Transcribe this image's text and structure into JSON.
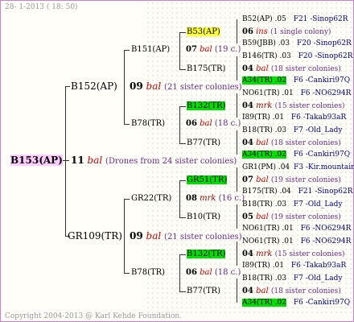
{
  "header": "28- 1-2013 ( 18: 50)",
  "footer": "Copyright 2004-2013 @ Karl Kehde Foundation.",
  "root": {
    "queen": "B153(AP)",
    "num": "11",
    "mark": "bal",
    "note": "(Drones from 24 sister colonies)"
  },
  "g1": [
    {
      "queen": "B152(AP)",
      "num": "09",
      "mark": "bal",
      "note": "(21 sister colonies)"
    },
    {
      "queen": "GR109(TR)",
      "num": "09",
      "mark": "bal",
      "note": "(21 sister colonies)"
    }
  ],
  "g2": [
    {
      "queen": "B151(AP)",
      "num": "07",
      "mark": "bal",
      "note": "(19 c.)"
    },
    {
      "queen": "B78(TR)",
      "num": "06",
      "mark": "bal",
      "note": "(18 c.)"
    },
    {
      "queen": "GR22(TR)",
      "num": "08",
      "mark": "mrk",
      "note": "(16 c.)"
    },
    {
      "queen": "B78(TR)",
      "num": "06",
      "mark": "bal",
      "note": "(18 c.)"
    }
  ],
  "g3": [
    {
      "queen": "B53(AP)",
      "num": "06",
      "mark": "ins",
      "note": "(1 single colony)"
    },
    {
      "queen": "B175(TR)",
      "num": "04",
      "mark": "bal",
      "note": "(18 sister colonies)"
    },
    {
      "queen": "B132(TR)",
      "num": "04",
      "mark": "mrk",
      "note": "(15 sister colonies)"
    },
    {
      "queen": "B77(TR)",
      "num": "04",
      "mark": "bal",
      "note": "(18 sister colonies)"
    },
    {
      "queen": "GR51(TR)",
      "num": "07",
      "mark": "bal",
      "note": "(19 sister colonies)"
    },
    {
      "queen": "B10(TR)",
      "num": "05",
      "mark": "bal",
      "note": "(19 sister colonies)"
    },
    {
      "queen": "B132(TR)",
      "num": "04",
      "mark": "mrk",
      "note": "(15 sister colonies)"
    },
    {
      "queen": "B77(TR)",
      "num": "04",
      "mark": "bal",
      "note": "(18 sister colonies)"
    }
  ],
  "g4": [
    {
      "left": "B52(AP) .05",
      "right": "F21 -Sinop62R"
    },
    {
      "left": "B59(JBB) .03",
      "right": "F20 -Sinop62R"
    },
    {
      "left": "B146(TR) .03",
      "right": "F20 -Sinop62R"
    },
    {
      "left": "A34(TR) .02",
      "right": "F6 -Cankiri97Q"
    },
    {
      "left": "NO61(TR) .01",
      "right": "F6 -NO6294R"
    },
    {
      "left": "I89(TR) .01",
      "right": "F6 -Takab93aR"
    },
    {
      "left": "B18(TR) .03",
      "right": "F7 -Old_Lady"
    },
    {
      "left": "A34(TR) .02",
      "right": "F6 -Cankiri97Q"
    },
    {
      "left": "GR1(PM) .04",
      "right": "F3 -Kir.mountain06Q"
    },
    {
      "left": "B175(TR) .04",
      "right": "F21 -Sinop62R"
    },
    {
      "left": "B18(TR) .03",
      "right": "F7 -Old_Lady"
    },
    {
      "left": "NO61(TR) .01",
      "right": "F6 -NO6294R"
    },
    {
      "left": "NO61(TR) .01",
      "right": "F6 -NO6294R"
    },
    {
      "left": "I89(TR) .01",
      "right": "F6 -Takab93aR"
    },
    {
      "left": "B18(TR) .03",
      "right": "F7 -Old_Lady"
    },
    {
      "left": "A34(TR) .02",
      "right": "F6 -Cankiri97Q"
    }
  ]
}
